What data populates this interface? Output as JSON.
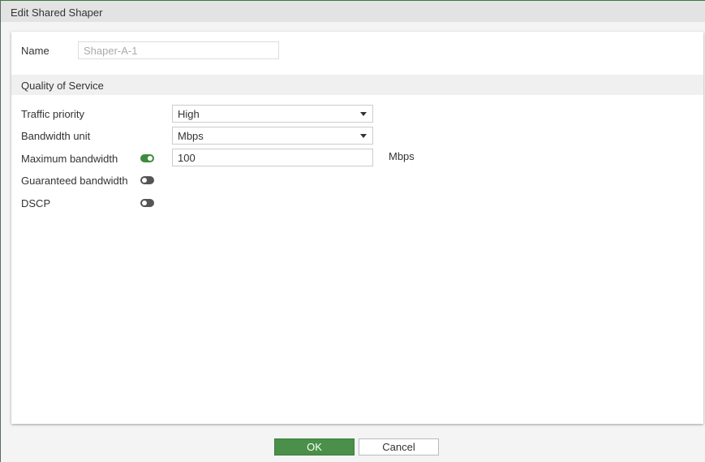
{
  "dialog": {
    "title": "Edit Shared Shaper"
  },
  "form": {
    "name_label": "Name",
    "name_value": "Shaper-A-1",
    "section": "Quality of Service",
    "traffic_priority_label": "Traffic priority",
    "traffic_priority": "High",
    "bandwidth_unit_label": "Bandwidth unit",
    "bandwidth_unit": "Mbps",
    "max_bw_label": "Maximum bandwidth",
    "max_bw_enabled": true,
    "max_bw_value": "100",
    "max_bw_unit": "Mbps",
    "guaranteed_bw_label": "Guaranteed bandwidth",
    "guaranteed_bw_enabled": false,
    "dscp_label": "DSCP",
    "dscp_enabled": false
  },
  "buttons": {
    "ok": "OK",
    "cancel": "Cancel"
  },
  "colors": {
    "accent": "#4a8f4a"
  }
}
